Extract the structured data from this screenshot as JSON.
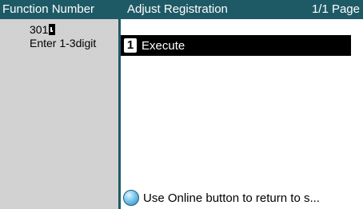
{
  "background_screen": {
    "title": "Function Number",
    "value": "301",
    "hint": "Enter 1-3digit"
  },
  "dialog": {
    "title": "Adjust Registration",
    "page_indicator": "1/1 Page",
    "items": [
      {
        "number": "1",
        "label": "Execute",
        "selected": true
      }
    ],
    "footer_text": "Use Online button to return to s..."
  },
  "colors": {
    "header_bg": "#1e5a66",
    "selected_bg": "#000000",
    "background_panel": "#c8c8c8"
  },
  "icons": {
    "footer_icon": "online-button-icon",
    "cursor": "enter-cursor-icon"
  }
}
